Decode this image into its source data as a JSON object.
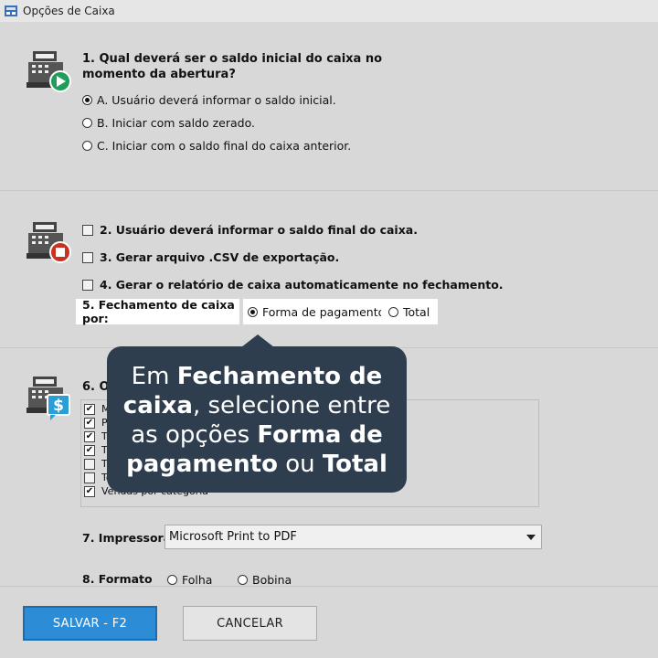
{
  "window": {
    "title": "Opções de Caixa"
  },
  "section1": {
    "question": "1. Qual deverá ser o saldo inicial do caixa no momento da abertura?",
    "options": [
      {
        "label": "A. Usuário deverá informar o saldo inicial.",
        "selected": true
      },
      {
        "label": "B. Iniciar com saldo zerado.",
        "selected": false
      },
      {
        "label": "C. Iniciar com o saldo final do caixa anterior.",
        "selected": false
      }
    ]
  },
  "section2": {
    "checks": [
      {
        "label": "2. Usuário deverá informar o saldo final do caixa.",
        "checked": false
      },
      {
        "label": "3. Gerar arquivo .CSV de exportação.",
        "checked": false
      },
      {
        "label": "4. Gerar o relatório de caixa automaticamente no fechamento.",
        "checked": false
      }
    ],
    "closing_label": "5. Fechamento de caixa por:",
    "closing_options": [
      {
        "label": "Forma de pagamento",
        "selected": true
      },
      {
        "label": "Total",
        "selected": false
      }
    ]
  },
  "section3": {
    "question_partial": "6. O",
    "list_items": [
      {
        "label": "M",
        "checked": true
      },
      {
        "label": "Pr",
        "checked": true
      },
      {
        "label": "Tr",
        "checked": true
      },
      {
        "label": "Tr",
        "checked": true
      },
      {
        "label": "Tr",
        "checked": false
      },
      {
        "label": "To",
        "checked": false
      },
      {
        "label": "Vendas por categoria",
        "checked": true
      }
    ],
    "printer_label": "7. Impressora",
    "printer_value": "Microsoft Print to PDF",
    "next_question_partial": "8. Formato",
    "next_opt1_partial": "Folha",
    "next_opt2_partial": "Bobina"
  },
  "tooltip": {
    "t1": "Em ",
    "b1": "Fechamento de caixa",
    "t2": ", selecione entre as opções ",
    "b2": "Forma de pagamento",
    "t3": " ou ",
    "b3": "Total"
  },
  "footer": {
    "save_label": "SALVAR - F2",
    "cancel_label": "CANCELAR"
  },
  "colors": {
    "accent": "#2c8dd6",
    "tooltip_bg": "#2e3e4e",
    "play_green": "#1e9e5a",
    "stop_red": "#c8321e",
    "dollar_blue": "#2a9fd6"
  }
}
